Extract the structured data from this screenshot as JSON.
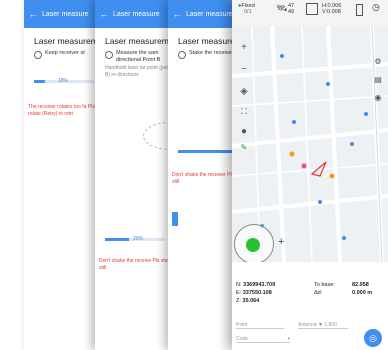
{
  "screen1": {
    "appbar_title": "Laser measure",
    "title": "Laser measurem",
    "option": "Keep receiver st",
    "progress_label": "18%",
    "progress": 0.18,
    "warning": "The receiver rotates too fa Pls rotate (Retry) to retri"
  },
  "screen2": {
    "appbar_title": "Laser measure",
    "title": "Laser measurem",
    "option": "Measure the sam directional Point B",
    "hint": "Handhold laser lar point (point B) re directions",
    "progress_label": "20%",
    "progress": 0.2,
    "warning": "Don't shake the receive Pls stay still"
  },
  "screen3": {
    "appbar_title": "Laser measure",
    "title": "Laser measureme",
    "option": "Stake the receiver",
    "warning": "Don't shake the receiver Pls stay still"
  },
  "map_screen": {
    "status": {
      "fix": "Fixed",
      "fix_sub": "0/1",
      "sats_top": "47",
      "sats_bottom": "49",
      "link": "H:0.006",
      "link_sub": "V:0.008"
    },
    "coords": {
      "n_label": "N:",
      "n_value": "3369943.709",
      "e_label": "E:",
      "e_value": "337550.108",
      "z_label": "Z:",
      "z_value": "35.064",
      "to_base_label": "To base:",
      "to_base_value": "82.958",
      "dz_label": "Δd:",
      "dz_value": "0.000 m"
    },
    "bottom": {
      "point_placeholder": "Point",
      "antenna_label": "Antenna",
      "antenna_value": "1.800",
      "code_placeholder": "Code"
    },
    "accent": "#3f8ef0",
    "warning_color": "#e53935"
  }
}
